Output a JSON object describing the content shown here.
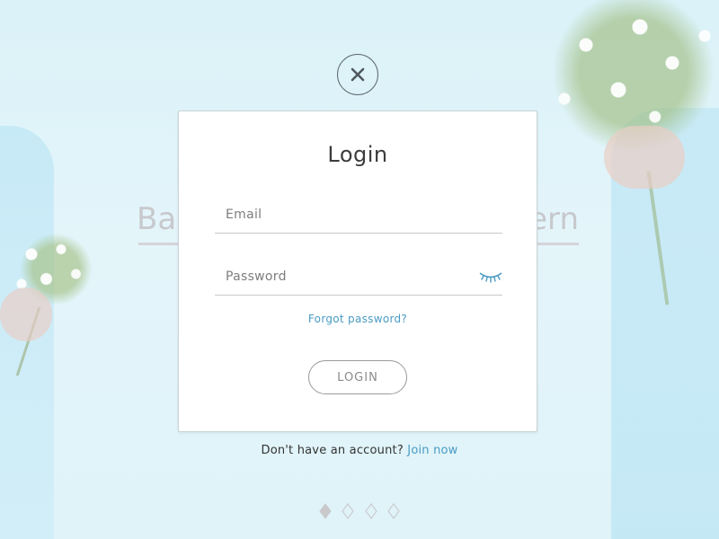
{
  "background": {
    "hero_title_left": "Bab",
    "hero_title_right": "ern"
  },
  "close_button": {
    "icon": "close-icon"
  },
  "login_modal": {
    "title": "Login",
    "email_field": {
      "placeholder": "Email",
      "value": ""
    },
    "password_field": {
      "placeholder": "Password",
      "value": "",
      "toggle_icon": "eye-closed-icon"
    },
    "forgot_password_label": "Forgot password?",
    "submit_label": "LOGIN"
  },
  "signup": {
    "prompt": "Don't have an account?",
    "link_label": "Join now"
  },
  "carousel": {
    "slide_count": 4,
    "active_index": 0
  },
  "colors": {
    "accent": "#4a9bc4",
    "background": "#dff3f9",
    "dot_active": "#c9c9cc",
    "dot_inactive": "#d3d6d8"
  }
}
